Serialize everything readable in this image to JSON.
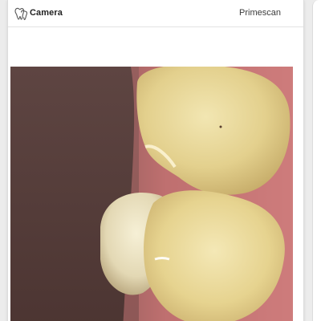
{
  "camera_panel": {
    "title": "Camera",
    "device": "Primescan",
    "icon": "teeth-icon"
  },
  "camera_view": {
    "image": "intraoral-camera-image-of-teeth"
  }
}
